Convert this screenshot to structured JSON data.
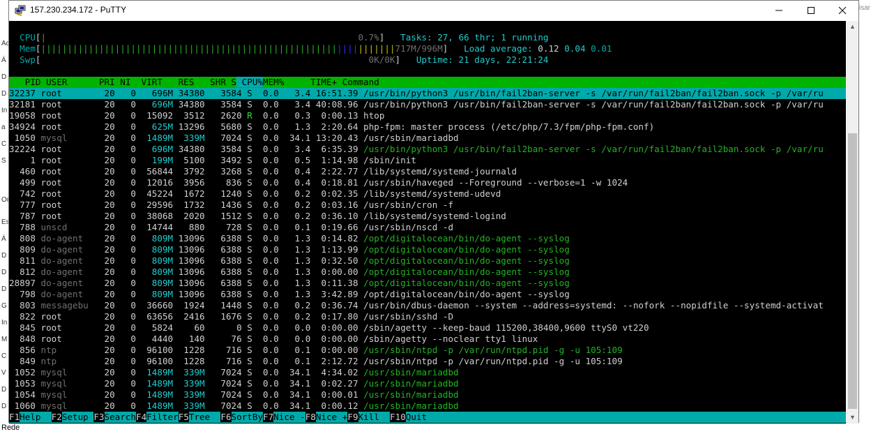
{
  "window": {
    "title": "157.230.234.172 - PuTTY",
    "minimize": "–",
    "maximize": "□",
    "close": "✕"
  },
  "background": {
    "left_fragments": [
      "Ac",
      "Á",
      "D",
      "D",
      "In",
      "a",
      "C",
      "S",
      "Or",
      "Est",
      "Á",
      "D",
      "D",
      "D",
      "G",
      "In",
      "M",
      "C",
      "V",
      "D",
      "D"
    ],
    "right_fragment": "isar",
    "bottom_label": "Rede"
  },
  "meters": {
    "cpu": {
      "label": "CPU",
      "bars": "|",
      "value": "0.7%"
    },
    "mem": {
      "label": "Mem",
      "bars_green": "||||||||||||||||||||||||||||||||||||||||||||||||||||||||",
      "bars_blue": "||||",
      "bars_yellow": "|||||||",
      "value": "717M/996M"
    },
    "swp": {
      "label": "Swp",
      "value": "0K/0K"
    }
  },
  "stats": {
    "tasks_label": "Tasks: ",
    "tasks": "27",
    "thr": "66",
    "running": "1",
    "load_label": "Load average: ",
    "load1": "0.12",
    "load5": "0.04",
    "load15": "0.01",
    "uptime_label": "Uptime: ",
    "uptime": "21 days, 22:21:24"
  },
  "columns": [
    "PID",
    "USER",
    "PRI",
    "NI",
    "VIRT",
    "RES",
    "SHR",
    "S",
    "CPU%",
    "MEM%",
    "TIME+",
    "Command"
  ],
  "processes": [
    {
      "pid": "32237",
      "user": "root",
      "pri": "20",
      "ni": "0",
      "virt": "696M",
      "res": "34380",
      "shr": "3584",
      "s": "S",
      "cpu": "0.0",
      "mem": "3.4",
      "time": "16:51.39",
      "cmd": "/usr/bin/python3 /usr/bin/fail2ban-server -s /var/run/fail2ban/fail2ban.sock -p /var/ru",
      "style": "sel"
    },
    {
      "pid": "32181",
      "user": "root",
      "pri": "20",
      "ni": "0",
      "virt": "696M",
      "res": "34380",
      "shr": "3584",
      "s": "S",
      "cpu": "0.0",
      "mem": "3.4",
      "time": "40:08.96",
      "cmd": "/usr/bin/python3 /usr/bin/fail2ban-server -s /var/run/fail2ban/fail2ban.sock -p /var/ru",
      "style": "proc"
    },
    {
      "pid": "19058",
      "user": "root",
      "pri": "20",
      "ni": "0",
      "virt": "15092",
      "res": "3512",
      "shr": "2620",
      "s": "R",
      "cpu": "0.0",
      "mem": "0.3",
      "time": "0:00.13",
      "cmd": "htop",
      "style": "proc"
    },
    {
      "pid": "34924",
      "user": "root",
      "pri": "20",
      "ni": "0",
      "virt": "625M",
      "res": "13296",
      "shr": "5680",
      "s": "S",
      "cpu": "0.0",
      "mem": "1.3",
      "time": "2:20.64",
      "cmd": "php-fpm: master process (/etc/php/7.3/fpm/php-fpm.conf)",
      "style": "proc"
    },
    {
      "pid": "1050",
      "user": "mysql",
      "pri": "20",
      "ni": "0",
      "virt": "1489M",
      "res": "339M",
      "shr": "7024",
      "s": "S",
      "cpu": "0.0",
      "mem": "34.1",
      "time": "13:20.43",
      "cmd": "/usr/sbin/mariadbd",
      "style": "proc"
    },
    {
      "pid": "32224",
      "user": "root",
      "pri": "20",
      "ni": "0",
      "virt": "696M",
      "res": "34380",
      "shr": "3584",
      "s": "S",
      "cpu": "0.0",
      "mem": "3.4",
      "time": "6:35.39",
      "cmd": "/usr/bin/python3 /usr/bin/fail2ban-server -s /var/run/fail2ban/fail2ban.sock -p /var/ru",
      "style": "thread"
    },
    {
      "pid": "1",
      "user": "root",
      "pri": "20",
      "ni": "0",
      "virt": "199M",
      "res": "5100",
      "shr": "3492",
      "s": "S",
      "cpu": "0.0",
      "mem": "0.5",
      "time": "1:14.98",
      "cmd": "/sbin/init",
      "style": "proc"
    },
    {
      "pid": "460",
      "user": "root",
      "pri": "20",
      "ni": "0",
      "virt": "56844",
      "res": "3792",
      "shr": "3268",
      "s": "S",
      "cpu": "0.0",
      "mem": "0.4",
      "time": "2:22.77",
      "cmd": "/lib/systemd/systemd-journald",
      "style": "proc"
    },
    {
      "pid": "499",
      "user": "root",
      "pri": "20",
      "ni": "0",
      "virt": "12016",
      "res": "3956",
      "shr": "836",
      "s": "S",
      "cpu": "0.0",
      "mem": "0.4",
      "time": "0:18.81",
      "cmd": "/usr/sbin/haveged --Foreground --verbose=1 -w 1024",
      "style": "proc"
    },
    {
      "pid": "742",
      "user": "root",
      "pri": "20",
      "ni": "0",
      "virt": "45224",
      "res": "1672",
      "shr": "1240",
      "s": "S",
      "cpu": "0.0",
      "mem": "0.2",
      "time": "0:02.35",
      "cmd": "/lib/systemd/systemd-udevd",
      "style": "proc"
    },
    {
      "pid": "777",
      "user": "root",
      "pri": "20",
      "ni": "0",
      "virt": "29596",
      "res": "1732",
      "shr": "1436",
      "s": "S",
      "cpu": "0.0",
      "mem": "0.2",
      "time": "0:03.16",
      "cmd": "/usr/sbin/cron -f",
      "style": "proc"
    },
    {
      "pid": "787",
      "user": "root",
      "pri": "20",
      "ni": "0",
      "virt": "38068",
      "res": "2020",
      "shr": "1512",
      "s": "S",
      "cpu": "0.0",
      "mem": "0.2",
      "time": "0:36.10",
      "cmd": "/lib/systemd/systemd-logind",
      "style": "proc"
    },
    {
      "pid": "788",
      "user": "unscd",
      "pri": "20",
      "ni": "0",
      "virt": "14744",
      "res": "880",
      "shr": "728",
      "s": "S",
      "cpu": "0.0",
      "mem": "0.1",
      "time": "0:19.66",
      "cmd": "/usr/sbin/nscd -d",
      "style": "proc"
    },
    {
      "pid": "808",
      "user": "do-agent",
      "pri": "20",
      "ni": "0",
      "virt": "809M",
      "res": "13096",
      "shr": "6388",
      "s": "S",
      "cpu": "0.0",
      "mem": "1.3",
      "time": "0:14.82",
      "cmd": "/opt/digitalocean/bin/do-agent --syslog",
      "style": "thread"
    },
    {
      "pid": "809",
      "user": "do-agent",
      "pri": "20",
      "ni": "0",
      "virt": "809M",
      "res": "13096",
      "shr": "6388",
      "s": "S",
      "cpu": "0.0",
      "mem": "1.3",
      "time": "1:13.99",
      "cmd": "/opt/digitalocean/bin/do-agent --syslog",
      "style": "thread"
    },
    {
      "pid": "811",
      "user": "do-agent",
      "pri": "20",
      "ni": "0",
      "virt": "809M",
      "res": "13096",
      "shr": "6388",
      "s": "S",
      "cpu": "0.0",
      "mem": "1.3",
      "time": "0:32.50",
      "cmd": "/opt/digitalocean/bin/do-agent --syslog",
      "style": "thread"
    },
    {
      "pid": "812",
      "user": "do-agent",
      "pri": "20",
      "ni": "0",
      "virt": "809M",
      "res": "13096",
      "shr": "6388",
      "s": "S",
      "cpu": "0.0",
      "mem": "1.3",
      "time": "0:00.00",
      "cmd": "/opt/digitalocean/bin/do-agent --syslog",
      "style": "thread"
    },
    {
      "pid": "28897",
      "user": "do-agent",
      "pri": "20",
      "ni": "0",
      "virt": "809M",
      "res": "13096",
      "shr": "6388",
      "s": "S",
      "cpu": "0.0",
      "mem": "1.3",
      "time": "0:11.38",
      "cmd": "/opt/digitalocean/bin/do-agent --syslog",
      "style": "thread"
    },
    {
      "pid": "798",
      "user": "do-agent",
      "pri": "20",
      "ni": "0",
      "virt": "809M",
      "res": "13096",
      "shr": "6388",
      "s": "S",
      "cpu": "0.0",
      "mem": "1.3",
      "time": "3:42.89",
      "cmd": "/opt/digitalocean/bin/do-agent --syslog",
      "style": "proc"
    },
    {
      "pid": "803",
      "user": "messagebu",
      "pri": "20",
      "ni": "0",
      "virt": "36660",
      "res": "1924",
      "shr": "1448",
      "s": "S",
      "cpu": "0.0",
      "mem": "0.2",
      "time": "0:36.74",
      "cmd": "/usr/bin/dbus-daemon --system --address=systemd: --nofork --nopidfile --systemd-activat",
      "style": "proc"
    },
    {
      "pid": "822",
      "user": "root",
      "pri": "20",
      "ni": "0",
      "virt": "63656",
      "res": "2416",
      "shr": "1676",
      "s": "S",
      "cpu": "0.0",
      "mem": "0.2",
      "time": "0:17.80",
      "cmd": "/usr/sbin/sshd -D",
      "style": "proc"
    },
    {
      "pid": "845",
      "user": "root",
      "pri": "20",
      "ni": "0",
      "virt": "5824",
      "res": "60",
      "shr": "0",
      "s": "S",
      "cpu": "0.0",
      "mem": "0.0",
      "time": "0:00.00",
      "cmd": "/sbin/agetty --keep-baud 115200,38400,9600 ttyS0 vt220",
      "style": "proc"
    },
    {
      "pid": "848",
      "user": "root",
      "pri": "20",
      "ni": "0",
      "virt": "4440",
      "res": "140",
      "shr": "76",
      "s": "S",
      "cpu": "0.0",
      "mem": "0.0",
      "time": "0:00.00",
      "cmd": "/sbin/agetty --noclear tty1 linux",
      "style": "proc"
    },
    {
      "pid": "856",
      "user": "ntp",
      "pri": "20",
      "ni": "0",
      "virt": "96100",
      "res": "1228",
      "shr": "716",
      "s": "S",
      "cpu": "0.0",
      "mem": "0.1",
      "time": "0:00.00",
      "cmd": "/usr/sbin/ntpd -p /var/run/ntpd.pid -g -u 105:109",
      "style": "thread"
    },
    {
      "pid": "849",
      "user": "ntp",
      "pri": "20",
      "ni": "0",
      "virt": "96100",
      "res": "1228",
      "shr": "716",
      "s": "S",
      "cpu": "0.0",
      "mem": "0.1",
      "time": "2:12.72",
      "cmd": "/usr/sbin/ntpd -p /var/run/ntpd.pid -g -u 105:109",
      "style": "proc"
    },
    {
      "pid": "1052",
      "user": "mysql",
      "pri": "20",
      "ni": "0",
      "virt": "1489M",
      "res": "339M",
      "shr": "7024",
      "s": "S",
      "cpu": "0.0",
      "mem": "34.1",
      "time": "4:34.02",
      "cmd": "/usr/sbin/mariadbd",
      "style": "thread"
    },
    {
      "pid": "1053",
      "user": "mysql",
      "pri": "20",
      "ni": "0",
      "virt": "1489M",
      "res": "339M",
      "shr": "7024",
      "s": "S",
      "cpu": "0.0",
      "mem": "34.1",
      "time": "0:02.27",
      "cmd": "/usr/sbin/mariadbd",
      "style": "thread"
    },
    {
      "pid": "1054",
      "user": "mysql",
      "pri": "20",
      "ni": "0",
      "virt": "1489M",
      "res": "339M",
      "shr": "7024",
      "s": "S",
      "cpu": "0.0",
      "mem": "34.1",
      "time": "0:00.01",
      "cmd": "/usr/sbin/mariadbd",
      "style": "thread"
    },
    {
      "pid": "1060",
      "user": "mysql",
      "pri": "20",
      "ni": "0",
      "virt": "1489M",
      "res": "339M",
      "shr": "7024",
      "s": "S",
      "cpu": "0.0",
      "mem": "34.1",
      "time": "0:00.12",
      "cmd": "/usr/sbin/mariadbd",
      "style": "thread"
    }
  ],
  "function_keys": [
    {
      "key": "F1",
      "label": "Help  "
    },
    {
      "key": "F2",
      "label": "Setup "
    },
    {
      "key": "F3",
      "label": "Search"
    },
    {
      "key": "F4",
      "label": "Filter"
    },
    {
      "key": "F5",
      "label": "Tree  "
    },
    {
      "key": "F6",
      "label": "SortBy"
    },
    {
      "key": "F7",
      "label": "Nice -"
    },
    {
      "key": "F8",
      "label": "Nice +"
    },
    {
      "key": "F9",
      "label": "Kill  "
    },
    {
      "key": "F10",
      "label": "Quit"
    }
  ],
  "colors": {
    "header_bg": "#00b300",
    "selected_bg": "#00aaaa",
    "terminal_bg": "#000000"
  }
}
